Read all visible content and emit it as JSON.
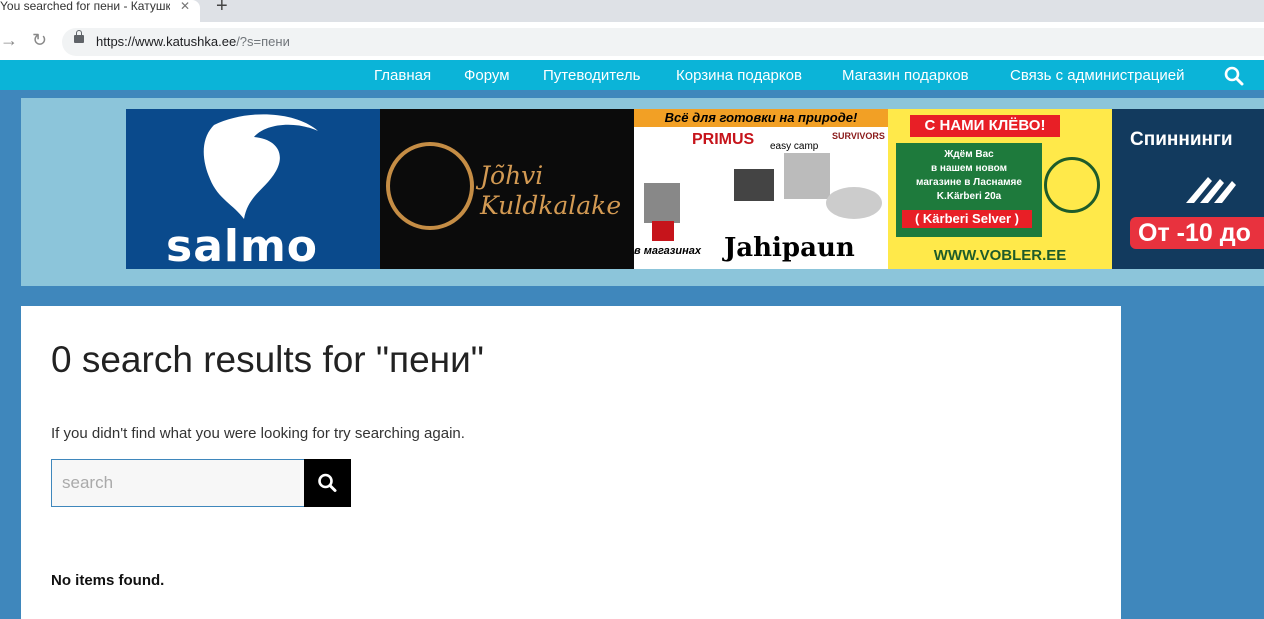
{
  "browser": {
    "tab_title": "You searched for пени - Катушка",
    "tab_close": "✕",
    "new_tab": "+",
    "back": "←",
    "forward": "→",
    "reload": "↻",
    "url_host": "https://www.katushka.ee",
    "url_path": "/?s=пени"
  },
  "nav": {
    "items": [
      "Главная",
      "Форум",
      "Путеводитель",
      "Корзина подарков",
      "Магазин подарков",
      "Связь с администрацией"
    ],
    "search_icon": "search-icon"
  },
  "banners": {
    "salmo": "salmo",
    "kuld_line1": "Jõhvi",
    "kuld_line2": "Kuldkalake",
    "ad3_head": "Всё для готовки на природе!",
    "ad3_primus": "PRIMUS",
    "ad3_easy": "easy camp",
    "ad3_surv": "SURVIVORS",
    "ad3_foot": "в магазинах",
    "ad3_brand": "Jahipaun",
    "ad4_top": "С НАМИ КЛЁВО!",
    "ad4_lines": [
      "Ждём Вас",
      "в нашем новом",
      "магазине в Ласнамяе",
      "K.Kärberi 20a"
    ],
    "ad4_red": "( Kärberi Selver )",
    "ad4_url": "WWW.VOBLER.EE",
    "ad5_title": "Спиннинги",
    "ad5_sale": "От -10 до"
  },
  "content": {
    "title": "0 search results for \"пени\"",
    "hint": "If you didn't find what you were looking for try searching again.",
    "search_placeholder": "search",
    "no_items": "No items found."
  },
  "colors": {
    "page_bg": "#3f87bc",
    "nav_bg": "#0bb4d8",
    "banner_bg": "#8cc5da"
  }
}
